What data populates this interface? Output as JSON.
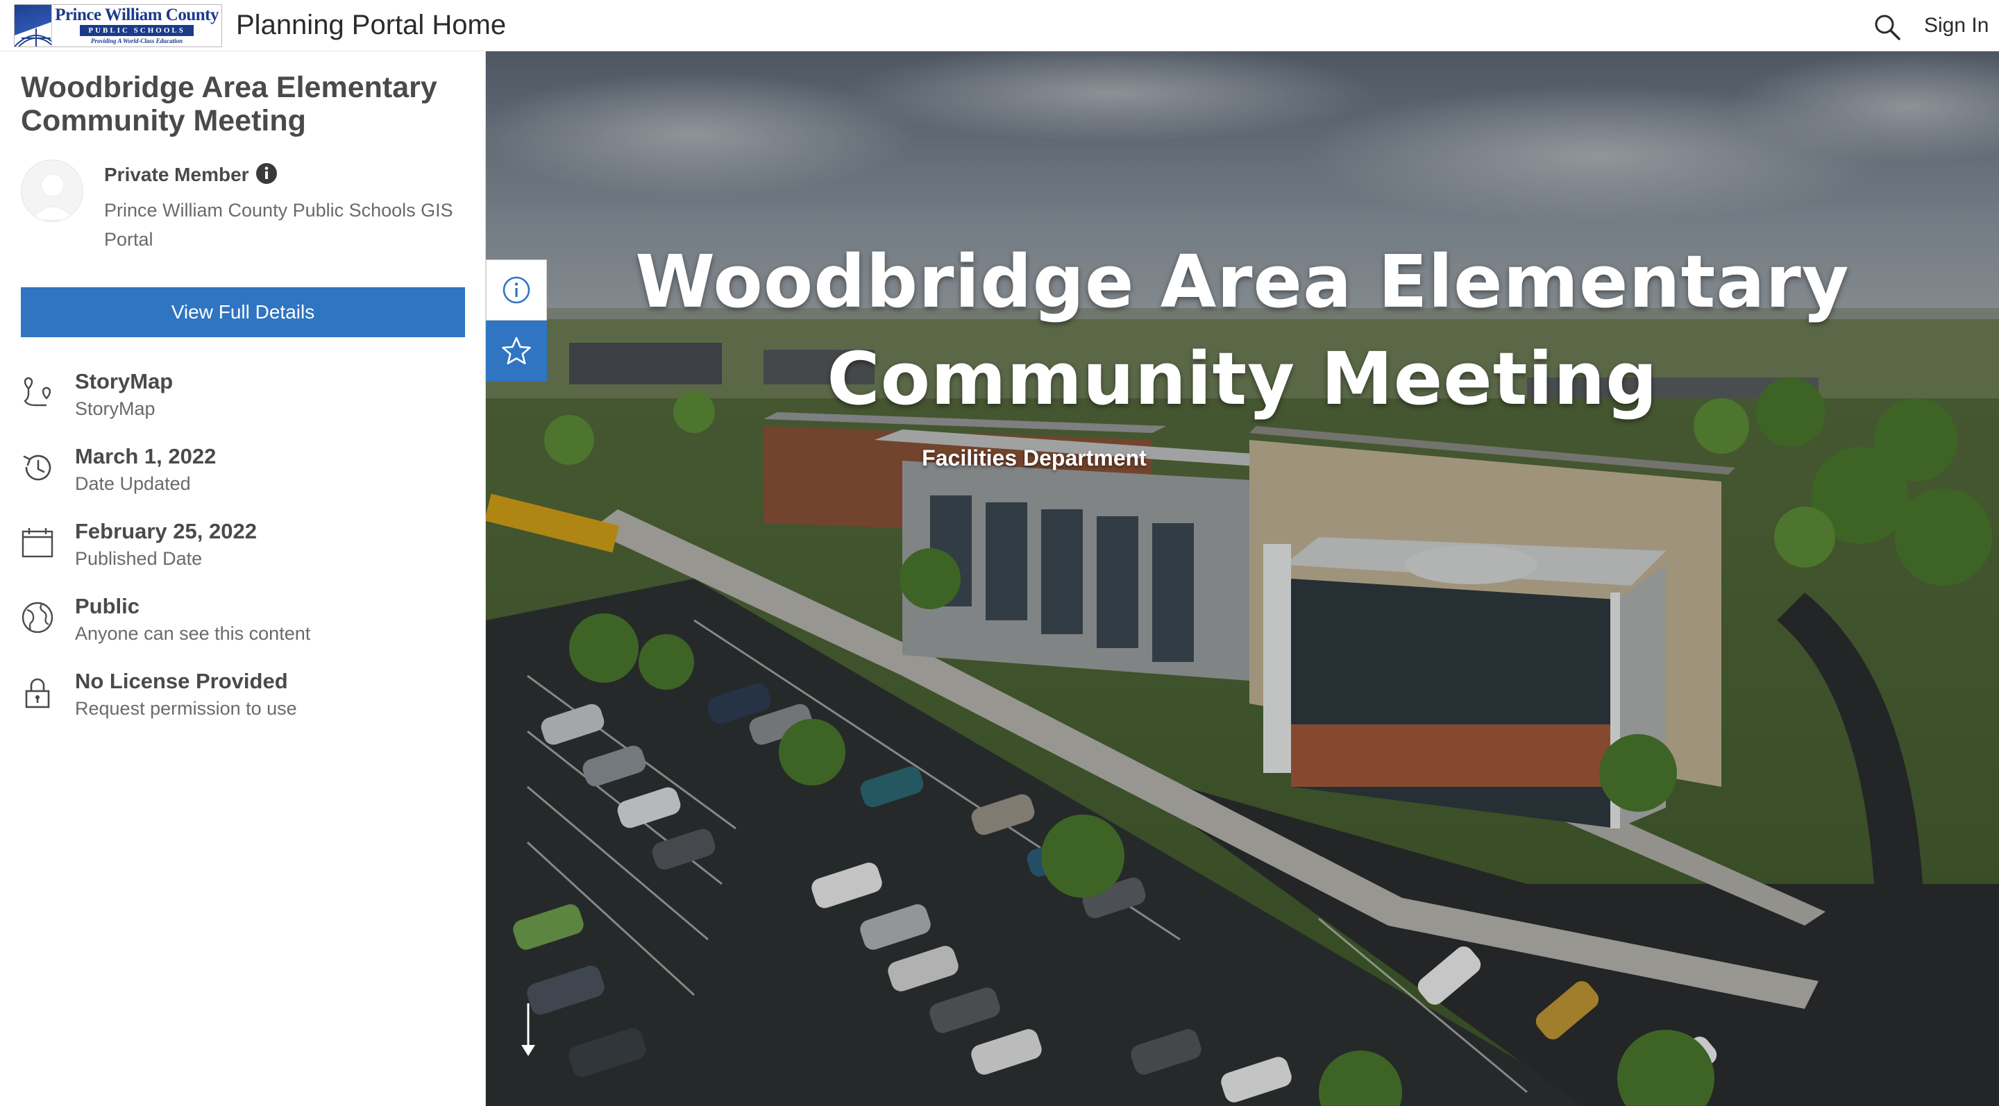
{
  "header": {
    "logo": {
      "line1": "Prince William County",
      "line2": "PUBLIC SCHOOLS",
      "tagline": "Providing A World-Class Education"
    },
    "title": "Planning Portal Home",
    "search_icon": "search-icon",
    "sign_in_label": "Sign In"
  },
  "side": {
    "title": "Woodbridge Area Elementary Community Meeting",
    "owner": {
      "name": "Private Member",
      "info_icon": "info-icon",
      "org": "Prince William County Public Schools GIS Portal"
    },
    "view_details_label": "View Full Details",
    "meta": [
      {
        "icon": "storymap-icon",
        "title": "StoryMap",
        "sub": "StoryMap"
      },
      {
        "icon": "history-icon",
        "title": "March 1, 2022",
        "sub": "Date Updated"
      },
      {
        "icon": "calendar-icon",
        "title": "February 25, 2022",
        "sub": "Published Date"
      },
      {
        "icon": "globe-icon",
        "title": "Public",
        "sub": "Anyone can see this content"
      },
      {
        "icon": "lock-icon",
        "title": "No License Provided",
        "sub": "Request permission to use"
      }
    ]
  },
  "hero": {
    "title_line1": "Woodbridge Area Elementary",
    "title_line2": "Community Meeting",
    "subtitle": "Facilities Department",
    "scroll_icon": "arrow-down-icon"
  },
  "tools": {
    "info_icon": "info-icon",
    "favorite_icon": "star-icon"
  },
  "colors": {
    "accent": "#2f75c2",
    "text": "#4a4a4a",
    "muted": "#6a6a6a",
    "logo_blue": "#1c3b8a"
  }
}
